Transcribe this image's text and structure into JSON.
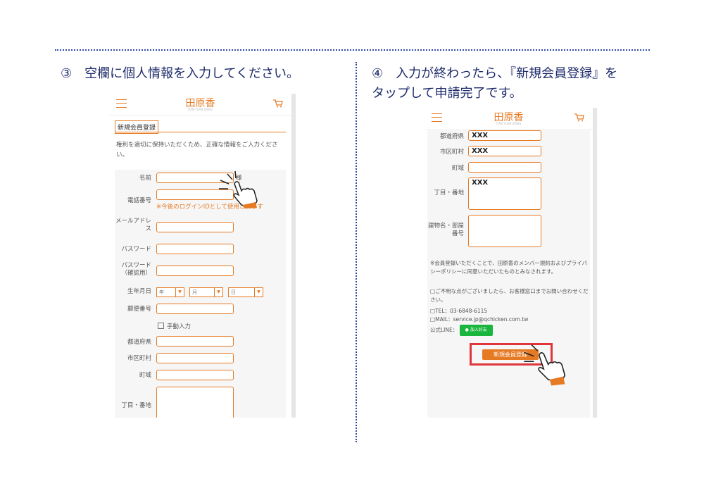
{
  "step3": {
    "title": "③　空欄に個人情報を入力してください。"
  },
  "step4": {
    "title": "④　入力が終わったら、『新規会員登録』を\nタップして申請完了です。"
  },
  "app": {
    "logo": "田原香",
    "logo_sub": "TIAN YUAN XIANG"
  },
  "phone1": {
    "section_tab": "新規会員登録",
    "intro": "権利を適切に保持いただくため、正確な情報をご入力ください。",
    "fields": {
      "name_label": "名前",
      "name_suffix": "様",
      "phone_label": "電話番号",
      "phone_note": "※今後のログインIDとして使用されます",
      "email_label": "メールアドレス",
      "password_label": "パスワード",
      "password_confirm_label": "パスワード（確認用）",
      "birthday_label": "生年月日",
      "year": "年",
      "month": "月",
      "day": "日",
      "postal_label": "郵便番号",
      "manual_input": "手動入力",
      "prefecture_label": "都道府県",
      "city_label": "市区町村",
      "town_label": "町域",
      "chome_label": "丁目・番地"
    }
  },
  "phone2": {
    "fields": {
      "prefecture_label": "都道府県",
      "prefecture_value": "XXX",
      "city_label": "市区町村",
      "city_value": "XXX",
      "town_label": "町域",
      "chome_label": "丁目・番地",
      "chome_value": "XXX",
      "building_label": "建物名・部屋番号"
    },
    "terms": "※会員登録いただくことで、田原香のメンバー規約およびプライバシーポリシーに同意いただいたものとみなされます。",
    "contact_intro": "ご不明な点がございましたら、お客様窓口までお問い合わせください。",
    "tel": "TEL：03-6848-6115",
    "mail": "MAIL：service.jp@qchicken.com.tw",
    "line_label": "公式LINE：",
    "line_button": "加入好友",
    "submit": "新規会員登録"
  },
  "colors": {
    "accent": "#e67a23",
    "highlight": "#e0353a",
    "title": "#1d2a6a",
    "line_green": "#1ab53c"
  },
  "icons": [
    "hamburger-icon",
    "cart-icon",
    "tap-hand-icon",
    "line-icon"
  ]
}
